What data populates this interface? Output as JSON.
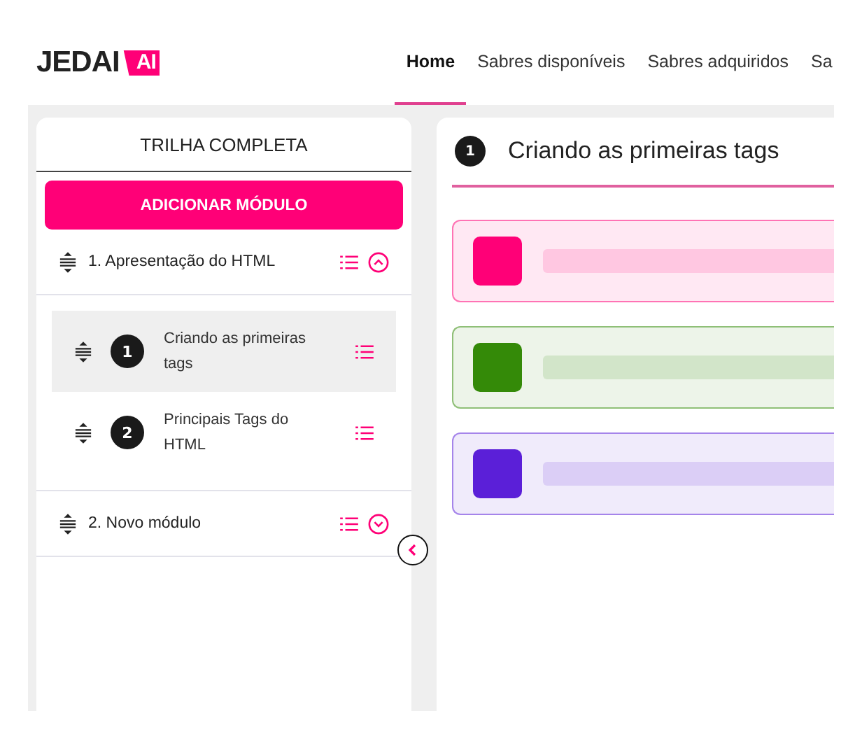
{
  "logo": {
    "text": "JEDAI",
    "mark": "AI"
  },
  "nav": [
    {
      "label": "Home",
      "selected": true
    },
    {
      "label": "Sabres disponíveis",
      "selected": false
    },
    {
      "label": "Sabres adquiridos",
      "selected": false
    },
    {
      "label": "Sa",
      "selected": false
    }
  ],
  "sidebar": {
    "title": "TRILHA COMPLETA",
    "add_button": "ADICIONAR MÓDULO",
    "modules": [
      {
        "label": "1. Apresentação do HTML",
        "expanded": true,
        "children": [
          {
            "number": "1",
            "label": "Criando as primeiras tags",
            "selected": true
          },
          {
            "number": "2",
            "label": "Principais Tags do HTML",
            "selected": false
          }
        ]
      },
      {
        "label": "2. Novo módulo",
        "expanded": false
      }
    ]
  },
  "lesson": {
    "number": "1",
    "title": "Criando as primeiras tags",
    "blocks": [
      {
        "color": "#ff0077"
      },
      {
        "color": "#348a08"
      },
      {
        "color": "#5b1fd8"
      }
    ]
  }
}
